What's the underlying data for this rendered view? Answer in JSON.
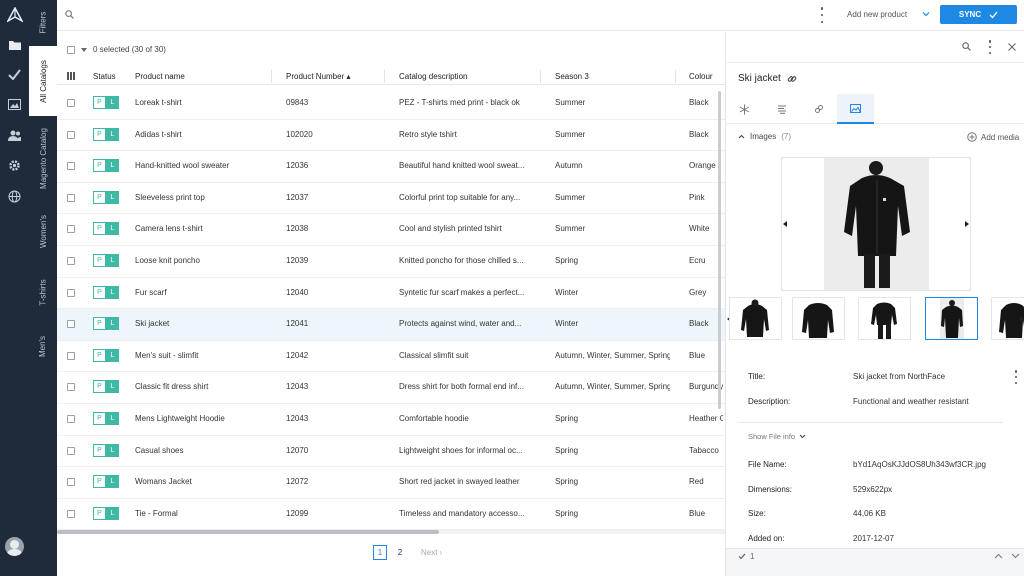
{
  "vtabs": [
    "Filters",
    "All Catalogs",
    "Magento Catalog",
    "Women's",
    "T-shirts",
    "Men's"
  ],
  "topbar": {
    "add_product": "Add new product",
    "sync_label": "SYNC"
  },
  "table": {
    "selection": "0 selected (30 of 30)",
    "headers": {
      "status": "Status",
      "name": "Product name",
      "number": "Product Number ▴",
      "desc": "Catalog description",
      "season": "Season 3",
      "colour": "Colour"
    },
    "status_p": "P",
    "status_l": "L",
    "rows": [
      {
        "name": "Loreak t-shirt",
        "number": "09843",
        "desc": "PEZ - T-shirts med print - black ok",
        "season": "Summer",
        "colour": "Black"
      },
      {
        "name": "Adidas t-shirt",
        "number": "102020",
        "desc": "Retro style tshirt",
        "season": "Summer",
        "colour": "Black"
      },
      {
        "name": "Hand-knitted wool sweater",
        "number": "12036",
        "desc": "Beautiful hand knitted wool sweat...",
        "season": "Autumn",
        "colour": "Orange"
      },
      {
        "name": "Sleeveless print top",
        "number": "12037",
        "desc": "Colorful print top suitable for any...",
        "season": "Summer",
        "colour": "Pink"
      },
      {
        "name": "Camera lens t-shirt",
        "number": "12038",
        "desc": "Cool and stylish printed tshirt",
        "season": "Summer",
        "colour": "White"
      },
      {
        "name": "Loose knit poncho",
        "number": "12039",
        "desc": "Knitted poncho for those chilled s...",
        "season": "Spring",
        "colour": "Ecru"
      },
      {
        "name": "Fur scarf",
        "number": "12040",
        "desc": "Syntetic fur scarf makes a perfect...",
        "season": "Winter",
        "colour": "Grey"
      },
      {
        "name": "Ski jacket",
        "number": "12041",
        "desc": "Protects against wind, water and...",
        "season": "Winter",
        "colour": "Black"
      },
      {
        "name": "Men's suit - slimfit",
        "number": "12042",
        "desc": "Classical slimfit suit",
        "season": "Autumn, Winter, Summer, Spring",
        "colour": "Blue"
      },
      {
        "name": "Classic fit dress shirt",
        "number": "12043",
        "desc": "Dress shirt for both formal end inf...",
        "season": "Autumn, Winter, Summer, Spring",
        "colour": "Burgundy"
      },
      {
        "name": "Mens Lightweight Hoodie",
        "number": "12043",
        "desc": "Comfortable hoodie",
        "season": "Spring",
        "colour": "Heather G"
      },
      {
        "name": "Casual shoes",
        "number": "12070",
        "desc": "Lightweight shoes for informal oc...",
        "season": "Spring",
        "colour": "Tabacco"
      },
      {
        "name": "Womans Jacket",
        "number": "12072",
        "desc": "Short red jacket in swayed leather",
        "season": "Spring",
        "colour": "Red"
      },
      {
        "name": "Tie - Formal",
        "number": "12099",
        "desc": "Timeless and mandatory accesso...",
        "season": "Spring",
        "colour": "Blue"
      }
    ],
    "highlighted_row": "Ski jacket"
  },
  "pager": {
    "page1": "1",
    "page2": "2",
    "next": "Next ›"
  },
  "panel": {
    "title": "Ski jacket",
    "images_label": "Images",
    "images_count": "(7)",
    "add_media": "Add media",
    "title_label": "Title:",
    "title_value": "Ski jacket from NorthFace",
    "description_label": "Description:",
    "description_value": "Functional and weather resistant",
    "show_file_info": "Show File info",
    "file_name_label": "File Name:",
    "file_name_value": "bYd1AqOsKJJdOS8Uh343wf3CR.jpg",
    "dimensions_label": "Dimensions:",
    "dimensions_value": "529x622px",
    "size_label": "Size:",
    "size_value": "44,06 KB",
    "added_label": "Added on:",
    "added_value": "2017-12-07",
    "footer_count": "1"
  },
  "colors": {
    "rail": "#1f2b3b",
    "accent": "#1e88e5",
    "status_teal": "#3fb8a5",
    "highlight_row": "#eef6fb"
  }
}
